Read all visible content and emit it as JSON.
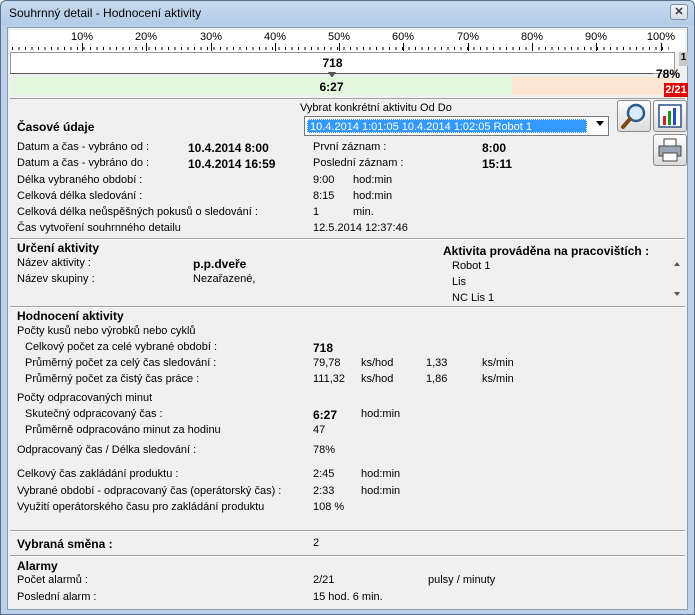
{
  "window": {
    "title": "Souhrnný detail - Hodnocení aktivity",
    "close_label": "✕"
  },
  "ruler": {
    "ticks": [
      "10%",
      "20%",
      "30%",
      "40%",
      "50%",
      "60%",
      "70%",
      "80%",
      "90%",
      "100%"
    ]
  },
  "progress": {
    "value1": "718",
    "value1_fraction": 0.5,
    "value2": "6:27",
    "value2_fraction": 0.78,
    "side_number": "1",
    "side_percent": "78%",
    "side_alarm": "2/21",
    "colors": {
      "done": "#e4f6df",
      "remaining": "#fde6d3",
      "alarm": "#e00000"
    }
  },
  "time": {
    "heading": "Časové údaje",
    "combo_label": "Vybrat konkrétní aktivitu Od Do",
    "combo_value": "10.4.2014 1:01:05   10.4.2014 1:02:05   Robot 1",
    "from_label": "Datum a čas - vybráno od :",
    "from_value": "10.4.2014 8:00",
    "to_label": "Datum a čas - vybráno do :",
    "to_value": "10.4.2014 16:59",
    "first_label": "První záznam :",
    "first_value": "8:00",
    "last_label": "Poslední záznam :",
    "last_value": "15:11",
    "period_label": "Délka vybraného období :",
    "period_value": "9:00",
    "period_unit": "hod:min",
    "total_label": "Celková délka sledování :",
    "total_value": "8:15",
    "total_unit": "hod:min",
    "fail_label": "Celková délka neůspěšných pokusů o sledování :",
    "fail_value": "1",
    "fail_unit": "min.",
    "created_label": "Čas vytvoření souhrnného detailu",
    "created_value": "12.5.2014 12:37:46"
  },
  "activity": {
    "heading": "Určení aktivity",
    "name_label": "Název aktivity :",
    "name_value": "p.p.dveře",
    "group_label": "Název skupiny :",
    "group_value": "Nezařazené,",
    "workplaces_heading": "Aktivita prováděna na pracovištích :",
    "workplaces": [
      "Robot 1",
      "Lis",
      "NC Lis 1"
    ]
  },
  "eval": {
    "heading": "Hodnocení aktivity",
    "pieces_label": "Počty kusů nebo výrobků nebo cyklů",
    "total_pieces_label": "Celkový počet za celé vybrané období :",
    "total_pieces_value": "718",
    "avg_total_label": "Průměrný počet za celý čas sledování :",
    "avg_total_value": "79,78",
    "avg_total_unit": "ks/hod",
    "avg_total_value2": "1,33",
    "avg_total_unit2": "ks/min",
    "avg_net_label": "Průměrný počet za čistý čas práce :",
    "avg_net_value": "111,32",
    "avg_net_unit": "ks/hod",
    "avg_net_value2": "1,86",
    "avg_net_unit2": "ks/min",
    "minutes_label": "Počty odpracovaných minut",
    "worked_label": "Skutečný odpracovaný čas :",
    "worked_value": "6:27",
    "worked_unit": "hod:min",
    "avg_worked_label": "Průměrně odpracováno minut za hodinu",
    "avg_worked_value": "47",
    "ratio_label": "Odpracovaný čas / Délka sledování :",
    "ratio_value": "78%",
    "setup_label": "Celkový čas zakládání produktu :",
    "setup_value": "2:45",
    "setup_unit": "hod:min",
    "op_label": "Vybrané období - odpracovaný čas (operátorský čas) :",
    "op_value": "2:33",
    "op_unit": "hod:min",
    "usage_label": "Využití operátorského času pro zakládání produktu",
    "usage_value": "108 %"
  },
  "shift": {
    "label": "Vybraná směna :",
    "value": "2"
  },
  "alarms": {
    "heading": "Alarmy",
    "count_label": "Počet alarmů :",
    "count_value": "2/21",
    "count_unit": "pulsy / minuty",
    "last_label": "Poslední alarm :",
    "last_value": "15 hod. 6 min."
  },
  "icons": {
    "search": "search-icon",
    "chart": "bar-chart-icon",
    "print": "printer-icon"
  }
}
